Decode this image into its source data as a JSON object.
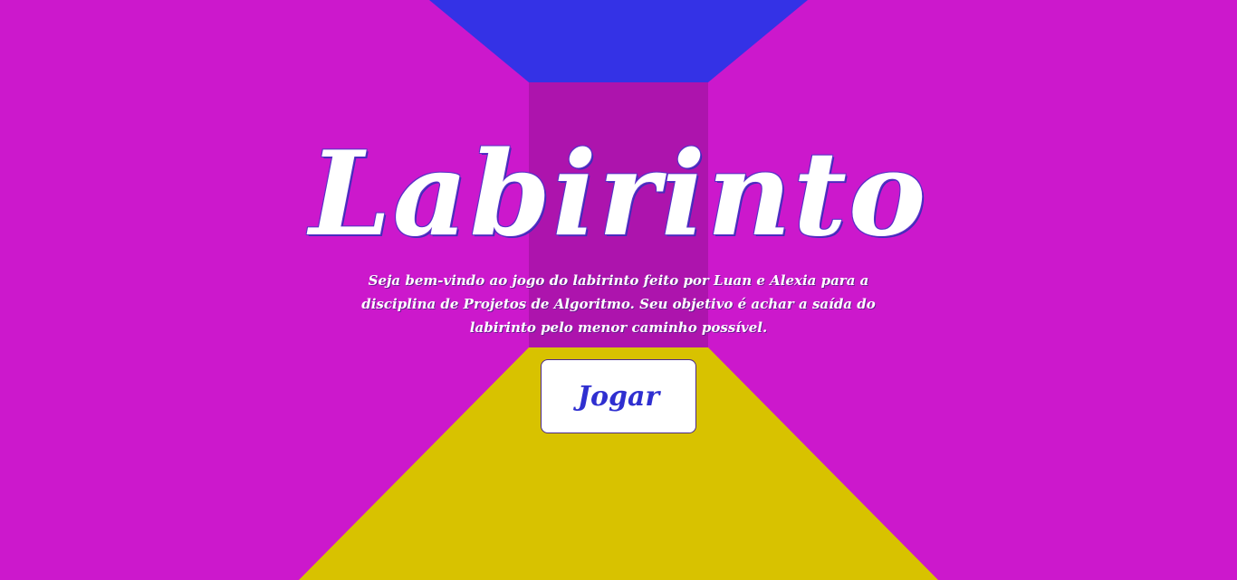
{
  "title": "Labirinto",
  "intro": "Seja bem-vindo ao jogo do labirinto feito por Luan e Alexia para a disciplina de Projetos de Algoritmo. Seu objetivo é achar a saída do labirinto pelo menor caminho possível.",
  "play_button_label": "Jogar",
  "colors": {
    "background": "#cc18cc",
    "ceiling": "#3432e6",
    "floor": "#d8c200",
    "far_wall": "#ad14ad",
    "text": "#ffffff",
    "button_text": "#2f2fd0"
  }
}
